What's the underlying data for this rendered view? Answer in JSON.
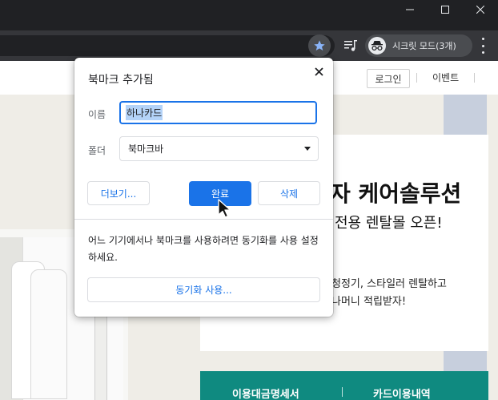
{
  "browser": {
    "incognito_label": "시크릿 모드(3개)"
  },
  "site": {
    "login": "로그인",
    "event": "이벤트",
    "hero_title": "자 케어솔루션",
    "hero_subtitle": "전용 렌탈몰 오픈!",
    "hero_desc_line1": "청정기, 스타일러 렌탈하고",
    "hero_desc_line2": "나머니 적립받자!",
    "bottom_left": "이용대금명세서",
    "bottom_right": "카드이용내역"
  },
  "dialog": {
    "title": "북마크 추가됨",
    "name_label": "이름",
    "name_value": "하나카드",
    "folder_label": "폴더",
    "folder_value": "북마크바",
    "more_button": "더보기...",
    "done_button": "완료",
    "delete_button": "삭제",
    "sync_message": "어느 기기에서나 북마크를 사용하려면 동기화를 사용 설정하세요.",
    "sync_button": "동기화 사용..."
  },
  "colors": {
    "accent": "#1a73e8",
    "teal": "#0f8a80"
  }
}
